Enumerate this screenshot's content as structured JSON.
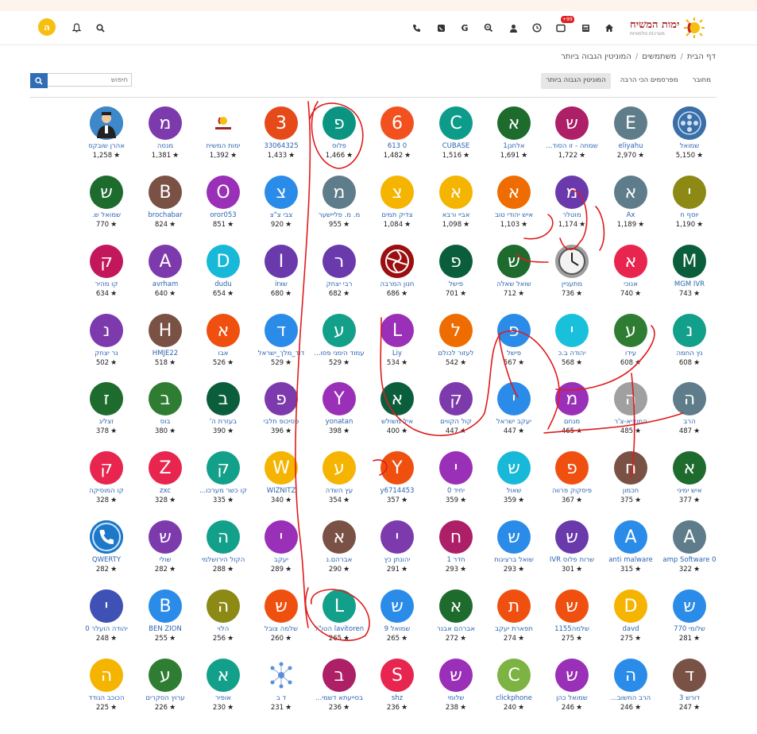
{
  "header": {
    "logo_text": "ימות המשיח",
    "logo_tagline": "מערכות טלפוניות",
    "notification_badge": "+99",
    "avatar_letter": "ה",
    "icons": [
      "phone-icon",
      "whatsapp-icon",
      "google-icon",
      "zoom-icon",
      "user-icon",
      "clock-icon",
      "message-icon",
      "calculator-icon",
      "home-icon"
    ]
  },
  "breadcrumb": [
    "דף הבית",
    "משתמשים",
    "המוניטין הגבוה ביותר"
  ],
  "tabs": [
    "מחובר",
    "מפרסמים הכי הרבה",
    "המוניטין הגבוה ביותר"
  ],
  "active_tab": 2,
  "search": {
    "placeholder": "חיפוש"
  },
  "colors": {
    "accent": "#2f6db5",
    "link": "#2a63b0",
    "annotation": "#e01b1b"
  },
  "users": [
    {
      "name": "שמואל",
      "score": "5,150",
      "letter": "",
      "color": "#3a6fa8",
      "img": "logo-circle"
    },
    {
      "name": "eliyahu",
      "score": "2,970",
      "letter": "E",
      "color": "#5f7c8a"
    },
    {
      "name": "שמחה - זו הסוד...",
      "score": "1,722",
      "letter": "ש",
      "color": "#ad1f66"
    },
    {
      "name": "אלחנן1",
      "score": "1,691",
      "letter": "א",
      "color": "#1e6b2e"
    },
    {
      "name": "CUBASE",
      "score": "1,516",
      "letter": "C",
      "color": "#0d9c8a"
    },
    {
      "name": "0 613",
      "score": "1,482",
      "letter": "6",
      "color": "#f2511f"
    },
    {
      "name": "פלוס",
      "score": "1,466",
      "letter": "פ",
      "color": "#0b9482"
    },
    {
      "name": "33064325",
      "score": "1,433",
      "letter": "3",
      "color": "#e64a19"
    },
    {
      "name": "ימות המשיח",
      "score": "1,392",
      "letter": "",
      "color": "#ffffff",
      "img": "logo"
    },
    {
      "name": "מנסה",
      "score": "1,381",
      "letter": "מ",
      "color": "#7c3aad"
    },
    {
      "name": "אהרן שובקס",
      "score": "1,258",
      "letter": "",
      "color": "#3d88c9",
      "img": "person"
    },
    {
      "name": "יוסף ח",
      "score": "1,190",
      "letter": "י",
      "color": "#8c8a14"
    },
    {
      "name": "Ax",
      "score": "1,189",
      "letter": "א",
      "color": "#5f7c8a"
    },
    {
      "name": "מוטלר",
      "score": "1,174",
      "letter": "מ",
      "color": "#6a3aad"
    },
    {
      "name": "איש יהודי טוב",
      "score": "1,103",
      "letter": "א",
      "color": "#ef6c00"
    },
    {
      "name": "אביי ורבא",
      "score": "1,098",
      "letter": "א",
      "color": "#f5b400"
    },
    {
      "name": "צדיק תמים",
      "score": "1,084",
      "letter": "צ",
      "color": "#f5b400"
    },
    {
      "name": "מ. מ. פליישער",
      "score": "955",
      "letter": "מ",
      "color": "#5f7c8a"
    },
    {
      "name": "צבי צ\"צ",
      "score": "920",
      "letter": "צ",
      "color": "#2a8ce8"
    },
    {
      "name": "oror053",
      "score": "851",
      "letter": "O",
      "color": "#9a2fb8"
    },
    {
      "name": "brochabar",
      "score": "824",
      "letter": "B",
      "color": "#7a5145"
    },
    {
      "name": "שמואל ש.",
      "score": "770",
      "letter": "ש",
      "color": "#1e6b2e"
    },
    {
      "name": "MGM IVR",
      "score": "743",
      "letter": "M",
      "color": "#0b5e3c"
    },
    {
      "name": "אנוכי",
      "score": "740",
      "letter": "א",
      "color": "#e8254e"
    },
    {
      "name": "מתעניין",
      "score": "736",
      "letter": "",
      "color": "#b0b0b0",
      "img": "clock"
    },
    {
      "name": "שואל שאלה",
      "score": "712",
      "letter": "ש",
      "color": "#1e6b2e"
    },
    {
      "name": "פישל",
      "score": "701",
      "letter": "פ",
      "color": "#0b5e3c"
    },
    {
      "name": "חנון המרבה",
      "score": "686",
      "letter": "",
      "color": "#9a1010",
      "img": "swirl"
    },
    {
      "name": "רבי יצחק",
      "score": "682",
      "letter": "ר",
      "color": "#6a3aad"
    },
    {
      "name": "שװir",
      "score": "680",
      "letter": "I",
      "color": "#6a3aad"
    },
    {
      "name": "dudu",
      "score": "654",
      "letter": "D",
      "color": "#18b8d8"
    },
    {
      "name": "avrham",
      "score": "640",
      "letter": "A",
      "color": "#7c3aad"
    },
    {
      "name": "קו מהיר",
      "score": "634",
      "letter": "ק",
      "color": "#c2185b"
    },
    {
      "name": "נץ החמה",
      "score": "608",
      "letter": "נ",
      "color": "#13a08a"
    },
    {
      "name": "עידו",
      "score": "608",
      "letter": "ע",
      "color": "#2e7d32"
    },
    {
      "name": "יהודה ב.כ",
      "score": "568",
      "letter": "י",
      "color": "#18c0dc"
    },
    {
      "name": "פישל",
      "score": "567",
      "letter": "פ",
      "color": "#2a8ce8"
    },
    {
      "name": "לעזור לכולם",
      "score": "542",
      "letter": "ל",
      "color": "#ef6c00"
    },
    {
      "name": "Liy",
      "score": "534",
      "letter": "L",
      "color": "#9a2fb8"
    },
    {
      "name": "עמוד הימני פסו...",
      "score": "529",
      "letter": "ע",
      "color": "#13a08a"
    },
    {
      "name": "דוד_מלך_ישראל",
      "score": "529",
      "letter": "ד",
      "color": "#2a8ce8"
    },
    {
      "name": "אבו",
      "score": "526",
      "letter": "א",
      "color": "#ef5010"
    },
    {
      "name": "HMJE22",
      "score": "518",
      "letter": "H",
      "color": "#7a5145"
    },
    {
      "name": "נר יצחק",
      "score": "502",
      "letter": "נ",
      "color": "#7c3aad"
    },
    {
      "name": "הרב",
      "score": "487",
      "letter": "ה",
      "color": "#5f7c8a"
    },
    {
      "name": "המוציא-צ'ר",
      "score": "485",
      "letter": "ה",
      "color": "#a0a0a0"
    },
    {
      "name": "מנחם",
      "score": "465",
      "letter": "מ",
      "color": "#9a2fb8"
    },
    {
      "name": "יעקב ישראל",
      "score": "447",
      "letter": "י",
      "color": "#2a8ce8"
    },
    {
      "name": "קול הקווים",
      "score": "447",
      "letter": "ק",
      "color": "#7c3aad"
    },
    {
      "name": "איל משולש",
      "score": "400",
      "letter": "א",
      "color": "#0b5e3c"
    },
    {
      "name": "yonatan",
      "score": "398",
      "letter": "Y",
      "color": "#9a2fb8"
    },
    {
      "name": "פסיכופ חלבי",
      "score": "396",
      "letter": "פ",
      "color": "#7c3aad"
    },
    {
      "name": "בעזרת ה'",
      "score": "390",
      "letter": "ב",
      "color": "#0b5e3c"
    },
    {
      "name": "בוס",
      "score": "380",
      "letter": "ב",
      "color": "#2e7d32"
    },
    {
      "name": "זצליג",
      "score": "378",
      "letter": "ז",
      "color": "#1e6b2e"
    },
    {
      "name": "איש ימיני",
      "score": "377",
      "letter": "א",
      "color": "#1e6b2e"
    },
    {
      "name": "חכמון",
      "score": "375",
      "letter": "ח",
      "color": "#7a5145"
    },
    {
      "name": "פיסקוק פרווה",
      "score": "367",
      "letter": "פ",
      "color": "#ef5010"
    },
    {
      "name": "שאול",
      "score": "359",
      "letter": "ש",
      "color": "#18b8d8"
    },
    {
      "name": "יחיד 0",
      "score": "359",
      "letter": "י",
      "color": "#9a2fb8"
    },
    {
      "name": "y6714453",
      "score": "357",
      "letter": "Y",
      "color": "#ef5010"
    },
    {
      "name": "עץ השדה",
      "score": "354",
      "letter": "ע",
      "color": "#f5b400"
    },
    {
      "name": "WIZNITZ",
      "score": "340",
      "letter": "W",
      "color": "#f5b400"
    },
    {
      "name": "קו כשר מערכו...",
      "score": "335",
      "letter": "ק",
      "color": "#13a08a"
    },
    {
      "name": "zxc",
      "score": "328",
      "letter": "Z",
      "color": "#e8254e"
    },
    {
      "name": "קו המוסיקה",
      "score": "328",
      "letter": "ק",
      "color": "#e8254e"
    },
    {
      "name": "amp Software 0",
      "score": "322",
      "letter": "A",
      "color": "#5f7c8a"
    },
    {
      "name": "anti malware",
      "score": "315",
      "letter": "A",
      "color": "#2a8ce8"
    },
    {
      "name": "שרות פלוס IVR",
      "score": "301",
      "letter": "ש",
      "color": "#6a3aad"
    },
    {
      "name": "שואל ברציגות",
      "score": "293",
      "letter": "ש",
      "color": "#2a8ce8"
    },
    {
      "name": "חדר 1",
      "score": "293",
      "letter": "ח",
      "color": "#ad1f66"
    },
    {
      "name": "יהונתן כץ",
      "score": "291",
      "letter": "י",
      "color": "#7c3aad"
    },
    {
      "name": "אברהם.נ",
      "score": "290",
      "letter": "א",
      "color": "#7a5145"
    },
    {
      "name": "יעקב",
      "score": "289",
      "letter": "י",
      "color": "#9a2fb8"
    },
    {
      "name": "הקול הירושלמי",
      "score": "288",
      "letter": "ה",
      "color": "#13a08a"
    },
    {
      "name": "שולי",
      "score": "282",
      "letter": "ש",
      "color": "#7c3aad"
    },
    {
      "name": "QWERTY",
      "score": "282",
      "letter": "",
      "color": "#1e78c8",
      "img": "phone"
    },
    {
      "name": "שלומי 770",
      "score": "281",
      "letter": "ש",
      "color": "#2a8ce8"
    },
    {
      "name": "davd",
      "score": "275",
      "letter": "D",
      "color": "#f5b400"
    },
    {
      "name": "שלמה1155",
      "score": "275",
      "letter": "ש",
      "color": "#ef5010"
    },
    {
      "name": "תפארת יעקב",
      "score": "274",
      "letter": "ת",
      "color": "#ef5010"
    },
    {
      "name": "אברהם אבנר",
      "score": "272",
      "letter": "א",
      "color": "#1e6b2e"
    },
    {
      "name": "שמואל 9",
      "score": "265",
      "letter": "ש",
      "color": "#2a8ce8"
    },
    {
      "name": "lavitoren הטו\"ל",
      "score": "265",
      "letter": "L",
      "color": "#13a08a"
    },
    {
      "name": "שלמה צובל",
      "score": "260",
      "letter": "ש",
      "color": "#ef5010"
    },
    {
      "name": "הלוי",
      "score": "256",
      "letter": "ה",
      "color": "#8c8a14"
    },
    {
      "name": "BEN ZION",
      "score": "255",
      "letter": "B",
      "color": "#2a8ce8"
    },
    {
      "name": "יהודה הועלר 0",
      "score": "248",
      "letter": "י",
      "color": "#3f51b5"
    },
    {
      "name": "דורש 3",
      "score": "247",
      "letter": "ד",
      "color": "#7a5145"
    },
    {
      "name": "הרב החשוב...",
      "score": "246",
      "letter": "ה",
      "color": "#2a8ce8"
    },
    {
      "name": "שמואל כהן",
      "score": "246",
      "letter": "ש",
      "color": "#9a2fb8"
    },
    {
      "name": "clickphone",
      "score": "240",
      "letter": "C",
      "color": "#7cb342"
    },
    {
      "name": "שלומי",
      "score": "238",
      "letter": "ש",
      "color": "#9a2fb8"
    },
    {
      "name": "shz",
      "score": "236",
      "letter": "S",
      "color": "#e8254e"
    },
    {
      "name": "בסייעתא דשמי...",
      "score": "236",
      "letter": "ב",
      "color": "#ad1f66"
    },
    {
      "name": "ד ב",
      "score": "231",
      "letter": "",
      "color": "#ffffff",
      "img": "network"
    },
    {
      "name": "אופיר",
      "score": "230",
      "letter": "א",
      "color": "#13a08a"
    },
    {
      "name": "ערוץ הסקרים",
      "score": "226",
      "letter": "ע",
      "color": "#2e7d32"
    },
    {
      "name": "הכוכב הנודד",
      "score": "225",
      "letter": "ה",
      "color": "#f5b400"
    }
  ]
}
